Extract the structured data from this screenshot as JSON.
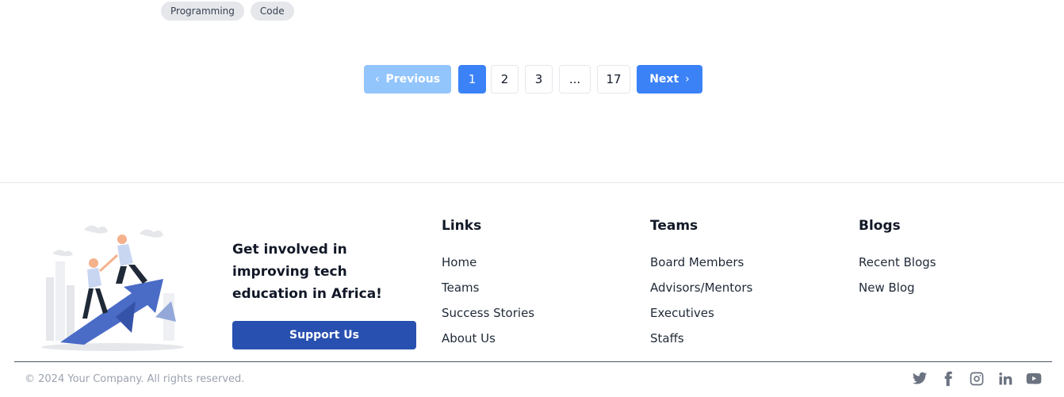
{
  "tags": [
    "Programming",
    "Code"
  ],
  "pagination": {
    "previous": "Previous",
    "next": "Next",
    "pages": [
      "1",
      "2",
      "3",
      "...",
      "17"
    ],
    "current": "1"
  },
  "footer": {
    "cta_text": "Get involved in improving tech education in Africa!",
    "cta_button": "Support Us",
    "links": {
      "title": "Links",
      "items": [
        "Home",
        "Teams",
        "Success Stories",
        "About Us"
      ]
    },
    "teams": {
      "title": "Teams",
      "items": [
        "Board Members",
        "Advisors/Mentors",
        "Executives",
        "Staffs"
      ]
    },
    "blogs": {
      "title": "Blogs",
      "items": [
        "Recent Blogs",
        "New Blog"
      ]
    },
    "copyright": "© 2024 Your Company. All rights reserved.",
    "social_icons": [
      "twitter-icon",
      "facebook-icon",
      "instagram-icon",
      "linkedin-icon",
      "youtube-icon"
    ]
  },
  "colors": {
    "primary": "#3b82f6",
    "primary_disabled": "#93c5fd",
    "support_button": "#2850b0"
  }
}
